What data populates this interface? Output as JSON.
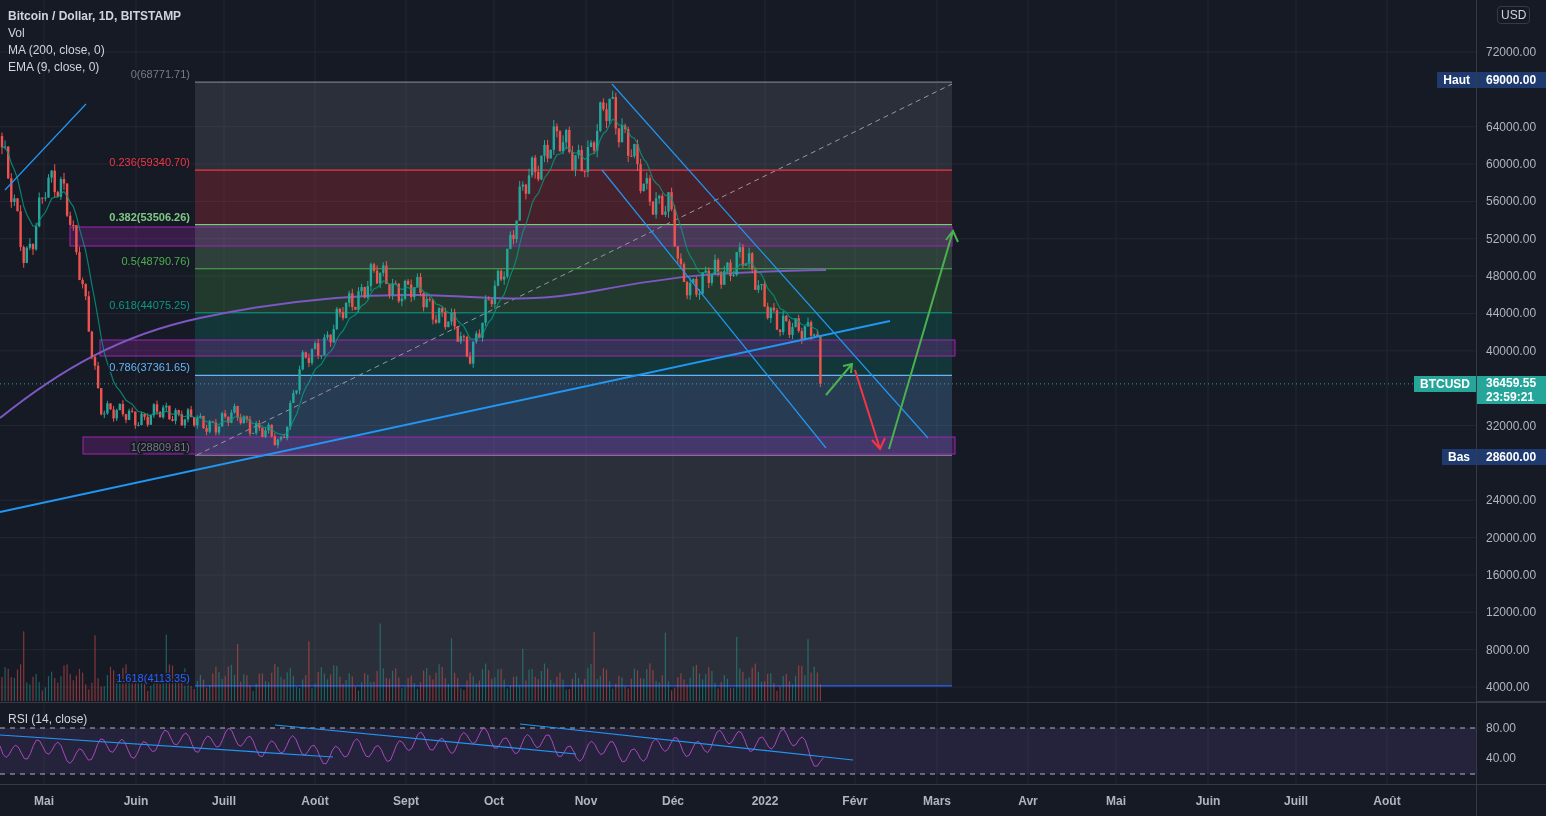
{
  "legend": {
    "title": "Bitcoin / Dollar, 1D, BITSTAMP",
    "indicators": [
      "Vol",
      "MA (200, close, 0)",
      "EMA (9, close, 0)"
    ]
  },
  "fib_levels": [
    {
      "label": "0(68771.71)",
      "color": "#787b86"
    },
    {
      "label": "0.236(59340.70)",
      "color": "#f23645"
    },
    {
      "label": "0.382(53506.26)",
      "color": "#81c784"
    },
    {
      "label": "0.5(48790.76)",
      "color": "#4caf50"
    },
    {
      "label": "0.618(44075.25)",
      "color": "#089981"
    },
    {
      "label": "0.786(37361.65)",
      "color": "#64b5f6"
    },
    {
      "label": "1(28809.81)",
      "color": "#787b86"
    },
    {
      "label": "1.618(4113.35)",
      "color": "#2962ff"
    }
  ],
  "price_axis": {
    "currency": "USD",
    "ticks": [
      "72000.00",
      "64000.00",
      "60000.00",
      "56000.00",
      "52000.00",
      "48000.00",
      "44000.00",
      "40000.00",
      "32000.00",
      "24000.00",
      "20000.00",
      "16000.00",
      "12000.00",
      "8000.00",
      "4000.00"
    ]
  },
  "markers": [
    {
      "label": "Haut",
      "value": "69000.00"
    },
    {
      "label": "Bas",
      "value": "28600.00"
    }
  ],
  "last_price": {
    "symbol": "BTCUSD",
    "price": "36459.55",
    "countdown": "23:59:21"
  },
  "rsi": {
    "title": "RSI (14, close)",
    "ticks": [
      "80.00",
      "40.00"
    ]
  },
  "time_axis": [
    "Mai",
    "Juin",
    "Juill",
    "Août",
    "Sept",
    "Oct",
    "Nov",
    "Déc",
    "2022",
    "Févr",
    "Mars",
    "Avr",
    "Mai",
    "Juin",
    "Juill",
    "Août"
  ]
}
